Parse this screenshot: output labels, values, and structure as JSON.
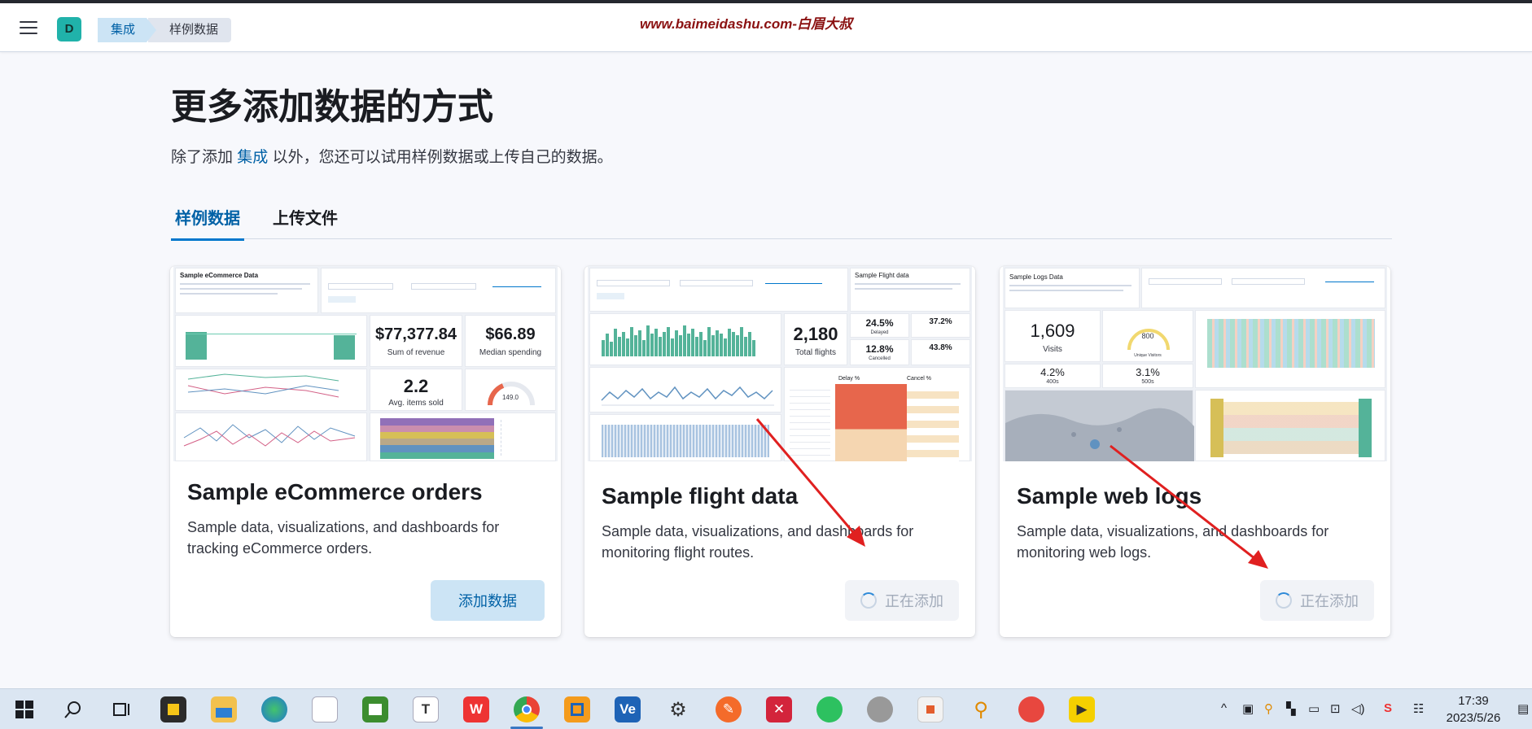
{
  "header": {
    "avatar_letter": "D",
    "breadcrumbs": [
      "集成",
      "样例数据"
    ],
    "watermark": "www.baimeidashu.com-白眉大叔"
  },
  "page": {
    "title": "更多添加数据的方式",
    "subtitle_pre": "除了添加 ",
    "subtitle_link": "集成",
    "subtitle_post": " 以外，您还可以试用样例数据或上传自己的数据。",
    "tabs": [
      "样例数据",
      "上传文件"
    ]
  },
  "cards": [
    {
      "title": "Sample eCommerce orders",
      "description": "Sample data, visualizations, and dashboards for tracking eCommerce orders.",
      "button": "添加数据",
      "thumb": {
        "header": "Sample eCommerce Data",
        "revenue": "$77,377.84",
        "revenue_label": "Sum of revenue",
        "median": "$66.89",
        "median_label": "Median spending",
        "items": "2.2",
        "items_label": "Avg. items sold",
        "gauge": "149.0"
      }
    },
    {
      "title": "Sample flight data",
      "description": "Sample data, visualizations, and dashboards for monitoring flight routes.",
      "button": "正在添加",
      "thumb": {
        "header": "Sample Flight data",
        "total": "2,180",
        "total_label": "Total flights",
        "delayed": "24.5%",
        "delayed_label": "Delayed",
        "cancelled": "12.8%",
        "cancelled_label": "Cancelled",
        "pct1": "37.2%",
        "pct2": "43.8%",
        "col1": "Delay %",
        "col2": "Cancel %"
      }
    },
    {
      "title": "Sample web logs",
      "description": "Sample data, visualizations, and dashboards for monitoring web logs.",
      "button": "正在添加",
      "thumb": {
        "header": "Sample Logs Data",
        "visits": "1,609",
        "visits_label": "Visits",
        "gauge": "800",
        "gauge_label": "Unique Visitors",
        "e400": "4.2%",
        "e400_label": "400s",
        "e500": "3.1%",
        "e500_label": "500s"
      }
    }
  ],
  "taskbar": {
    "time": "17:39",
    "date": "2023/5/26",
    "app_labels": [
      "W",
      "T",
      "Ve"
    ]
  },
  "colors": {
    "accent": "#0077cc",
    "link": "#0061a6",
    "button_bg": "#cce4f5",
    "arrow": "#e02020",
    "chart_green": "#54b399"
  }
}
